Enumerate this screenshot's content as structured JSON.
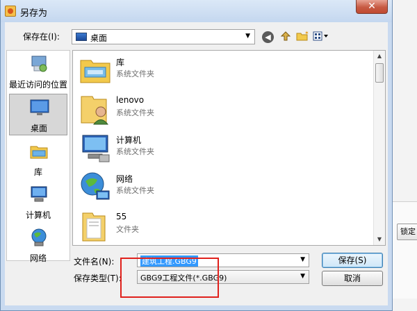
{
  "dialog": {
    "title": "另存为",
    "close_label": "✕",
    "save_in_label": "保存在(I):",
    "location": "桌面"
  },
  "icons": {
    "back": "back-arrow-icon",
    "up": "up-folder-icon",
    "new_folder": "new-folder-icon",
    "view": "view-menu-icon"
  },
  "places": [
    {
      "label": "最近访问的位置",
      "icon": "recent-places-icon"
    },
    {
      "label": "桌面",
      "icon": "desktop-icon",
      "selected": true
    },
    {
      "label": "库",
      "icon": "libraries-icon"
    },
    {
      "label": "计算机",
      "icon": "computer-icon"
    },
    {
      "label": "网络",
      "icon": "network-icon"
    }
  ],
  "files": [
    {
      "name": "库",
      "type": "系统文件夹",
      "icon": "libraries-folder-icon"
    },
    {
      "name": "lenovo",
      "type": "系统文件夹",
      "icon": "user-folder-icon"
    },
    {
      "name": "计算机",
      "type": "系统文件夹",
      "icon": "computer-icon"
    },
    {
      "name": "网络",
      "type": "系统文件夹",
      "icon": "network-globe-icon"
    },
    {
      "name": "55",
      "type": "文件夹",
      "icon": "folder-icon"
    }
  ],
  "fields": {
    "filename_label": "文件名(N):",
    "filename_value": "建筑工程.GBG9",
    "filetype_label": "保存类型(T):",
    "filetype_value": "GBG9工程文件(*.GBG9)"
  },
  "buttons": {
    "save": "保存(S)",
    "cancel": "取消"
  },
  "background_app": {
    "button_label": "锁定"
  },
  "colors": {
    "selection": "#3399ff",
    "annotation": "#e0201b",
    "title_bar": "#c9daf0"
  }
}
